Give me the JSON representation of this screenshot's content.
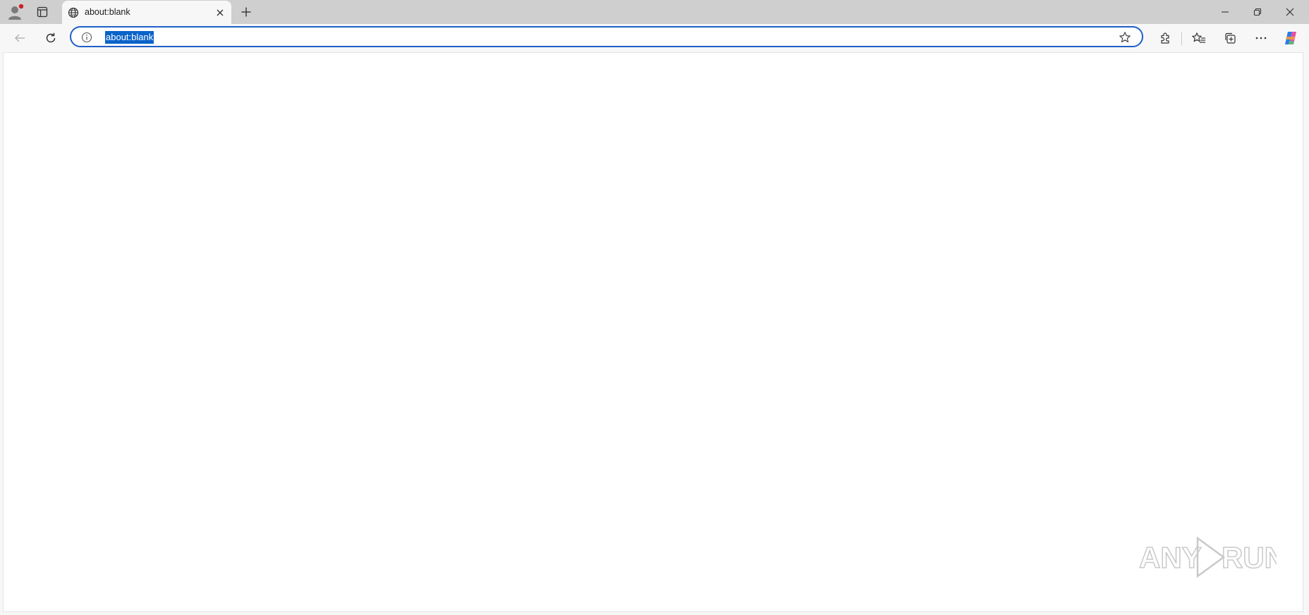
{
  "titlebar": {
    "tab": {
      "title": "about:blank",
      "favicon": "globe-icon"
    },
    "profile_icon": "profile-icon",
    "tab_actions_icon": "tab-actions-icon",
    "new_tab_icon": "plus-icon",
    "window_controls": [
      "minimize-icon",
      "restore-icon",
      "close-icon"
    ]
  },
  "toolbar": {
    "back_icon": "back-arrow-icon",
    "refresh_icon": "refresh-icon",
    "address": {
      "value": "about:blank",
      "info_icon": "info-icon",
      "favorite_icon": "star-icon"
    },
    "tools": [
      "extensions-icon",
      "favorites-icon",
      "collections-icon",
      "more-icon",
      "copilot-icon"
    ]
  },
  "watermark": {
    "text": "ANY RUN"
  },
  "colors": {
    "titlebar": "#cfcfcf",
    "toolbar": "#f7f7f7",
    "accent": "#1f5fc8",
    "selection": "#0a63c9",
    "profile_badge": "#d11f1f"
  }
}
